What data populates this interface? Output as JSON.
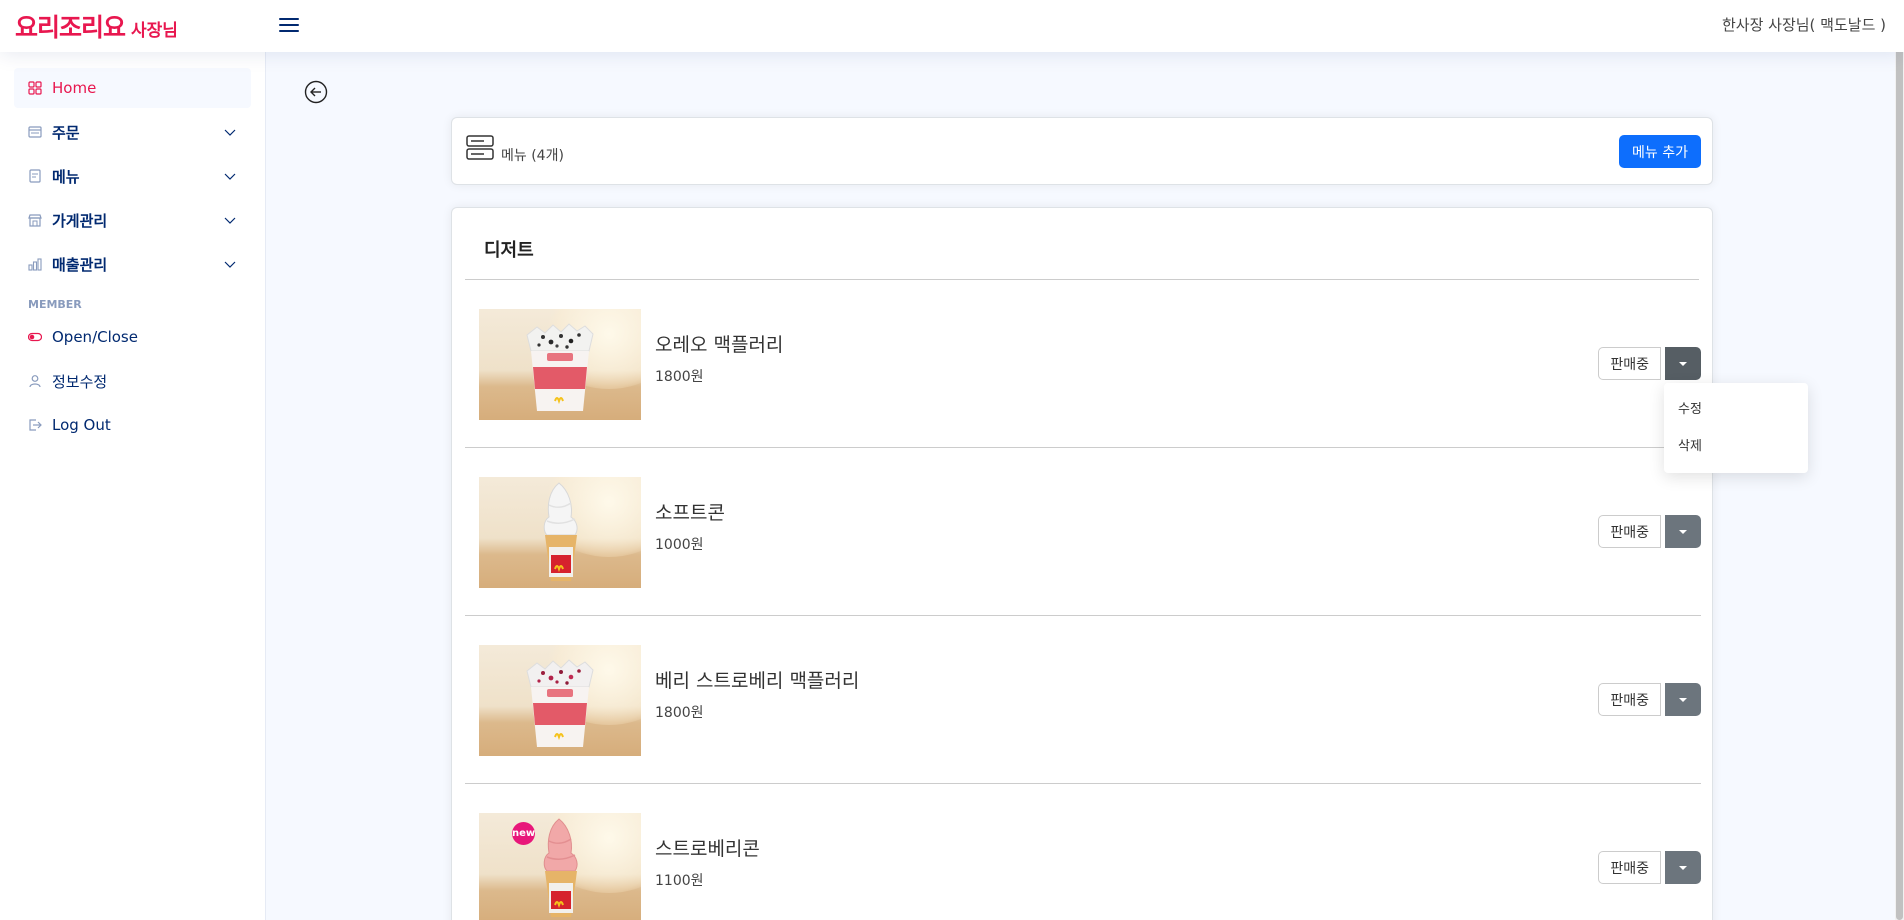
{
  "header": {
    "logo_main": "요리조리요",
    "logo_sub": "사장님",
    "user_label": "한사장 사장님( 맥도날드 )"
  },
  "sidebar": {
    "items": [
      {
        "label": "Home",
        "icon": "grid-icon"
      },
      {
        "label": "주문",
        "icon": "order-icon"
      },
      {
        "label": "메뉴",
        "icon": "menu-doc-icon"
      },
      {
        "label": "가게관리",
        "icon": "store-icon"
      },
      {
        "label": "매출관리",
        "icon": "bar-chart-icon"
      }
    ],
    "heading": "MEMBER",
    "member_items": [
      {
        "label": "Open/Close",
        "icon": "toggle-icon"
      },
      {
        "label": "정보수정",
        "icon": "person-icon"
      },
      {
        "label": "Log Out",
        "icon": "logout-icon"
      }
    ]
  },
  "menu_header": {
    "label": "메뉴 (4개)",
    "add_button": "메뉴 추가"
  },
  "category": {
    "title": "디저트",
    "items": [
      {
        "name": "오레오 맥플러리",
        "price": "1800원",
        "status": "판매중",
        "product": "mcflurry-oreo"
      },
      {
        "name": "소프트콘",
        "price": "1000원",
        "status": "판매중",
        "product": "soft-cone"
      },
      {
        "name": "베리 스트로베리 맥플러리",
        "price": "1800원",
        "status": "판매중",
        "product": "mcflurry-berry"
      },
      {
        "name": "스트로베리콘",
        "price": "1100원",
        "status": "판매중",
        "product": "strawberry-cone",
        "badge": "new"
      }
    ]
  },
  "dropdown": {
    "edit": "수정",
    "delete": "삭제"
  },
  "colors": {
    "brand": "#e8174f",
    "primary": "#0d6efd",
    "dropdown_toggle": "#6c757d",
    "nav_text": "#012970"
  }
}
